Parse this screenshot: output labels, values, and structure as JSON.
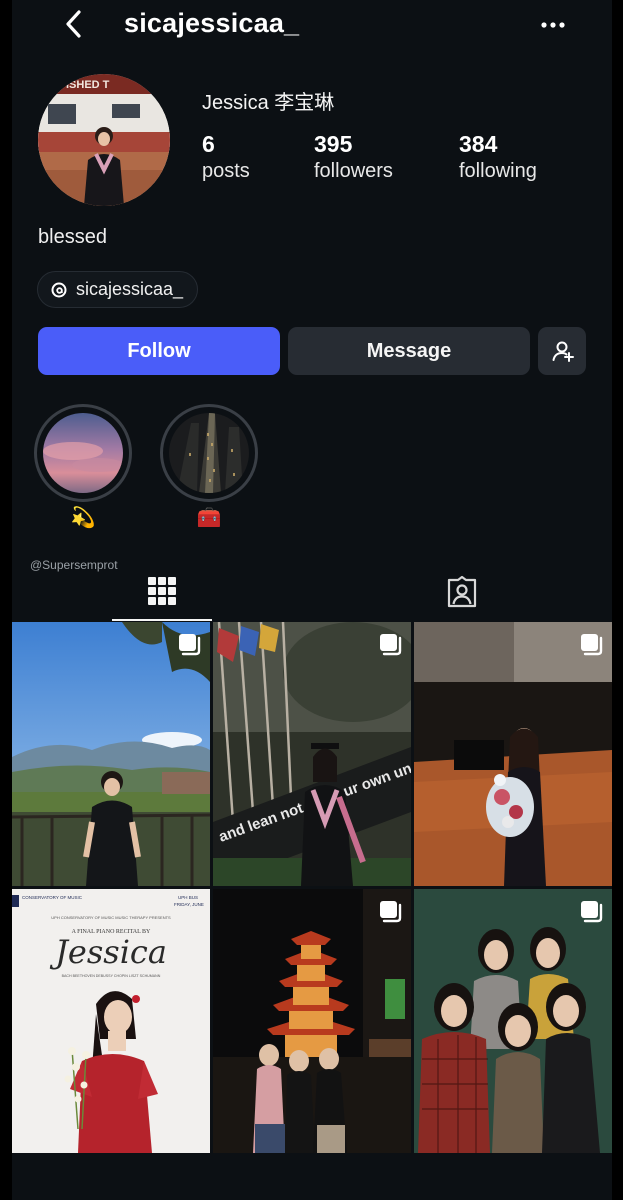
{
  "header": {
    "username": "sicajessicaa_",
    "back_icon": "chevron-left-icon",
    "more_icon": "more-horizontal-icon"
  },
  "profile": {
    "display_name": "Jessica 李宝琳",
    "bio": "blessed",
    "threads_handle": "sicajessicaa_",
    "avatar_sign_text": "ISHED T",
    "stats": {
      "posts": {
        "value": "6",
        "label": "posts"
      },
      "followers": {
        "value": "395",
        "label": "followers"
      },
      "following": {
        "value": "384",
        "label": "following"
      }
    }
  },
  "actions": {
    "follow": "Follow",
    "message": "Message",
    "add_user_icon": "person-add-icon"
  },
  "highlights": [
    {
      "emoji": "💫"
    },
    {
      "emoji": "🧰"
    }
  ],
  "watermark": "@Supersemprot",
  "tabs": [
    {
      "icon": "grid-icon",
      "active": true
    },
    {
      "icon": "tagged-person-icon",
      "active": false
    }
  ],
  "posts": [
    {
      "multi": true
    },
    {
      "multi": true,
      "sign_text": "and lean not on your own understanding"
    },
    {
      "multi": true
    },
    {
      "multi": false,
      "poster": {
        "left_header": "CONSERVATORY OF MUSIC",
        "right_header": "FRIDAY, JUNE",
        "right_header_top": "UPH BUS",
        "subtitle": "UPH CONSERVATORY OF MUSIC MUSIC THERAPY PRESENTS",
        "title": "A FINAL PIANO RECITAL BY",
        "name": "Jessica",
        "composers": "BACH   BEETHOVEN   DEBUSSY   CHOPIN   LISZT   SCHUMANN"
      }
    },
    {
      "multi": true
    },
    {
      "multi": true
    }
  ],
  "colors": {
    "background": "#0c1014",
    "follow_button": "#4a5df9",
    "secondary_button": "#272c33"
  }
}
